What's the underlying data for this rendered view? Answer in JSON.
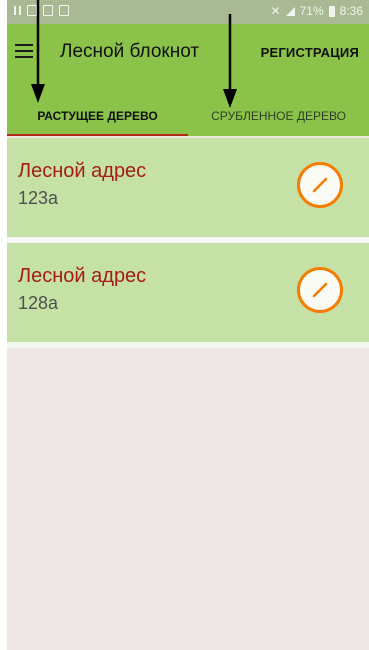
{
  "status_bar": {
    "battery": "71%",
    "time": "8:36"
  },
  "app_bar": {
    "title": "Лесной блокнот",
    "action": "РЕГИСТРАЦИЯ"
  },
  "tabs": [
    {
      "label": "РАСТУЩЕЕ ДЕРЕВО",
      "selected": true
    },
    {
      "label": "СРУБЛЕННОЕ ДЕРЕВО",
      "selected": false
    }
  ],
  "list": [
    {
      "title": "Лесной адрес",
      "number": "123а"
    },
    {
      "title": "Лесной адрес",
      "number": "128а"
    }
  ],
  "colors": {
    "app_bar": "#8bc34a",
    "card": "#c5e1a5",
    "accent": "#f57c00",
    "title_text": "#a51c12",
    "background": "#efe7e6"
  }
}
